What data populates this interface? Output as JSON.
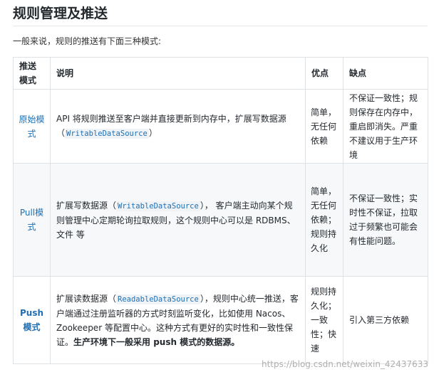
{
  "heading": "规则管理及推送",
  "intro": "一般来说，规则的推送有下面三种模式:",
  "table": {
    "headers": {
      "mode": "推送模式",
      "desc": "说明",
      "pros": "优点",
      "cons": "缺点"
    },
    "rows": [
      {
        "mode": "原始模式",
        "desc_before": "API 将规则推送至客户端并直接更新到内存中，扩展写数据源（",
        "desc_code": "WritableDataSource",
        "desc_after": "）",
        "desc_bold": "",
        "pros": "简单，无任何依赖",
        "cons": "不保证一致性；规则保存在内存中，重启即消失。严重不建议用于生产环境"
      },
      {
        "mode": "Pull模式",
        "desc_before": "扩展写数据源（",
        "desc_code": "WritableDataSource",
        "desc_after": "）， 客户端主动向某个规则管理中心定期轮询拉取规则，这个规则中心可以是 RDBMS、文件 等",
        "desc_bold": "",
        "pros": "简单，无任何依赖；规则持久化",
        "cons": "不保证一致性；实时性不保证，拉取过于频繁也可能会有性能问题。"
      },
      {
        "mode": "Push模式",
        "desc_before": "扩展读数据源（",
        "desc_code": "ReadableDataSource",
        "desc_after": "），规则中心统一推送，客户端通过注册监听器的方式时刻监听变化，比如使用 Nacos、Zookeeper 等配置中心。这种方式有更好的实时性和一致性保证。",
        "desc_bold": "生产环境下一般采用 push 模式的数据源。",
        "pros": "规则持久化；一致性；快速",
        "cons": "引入第三方依赖"
      }
    ]
  },
  "watermark": "https://blog.csdn.net/weixin_42437633"
}
